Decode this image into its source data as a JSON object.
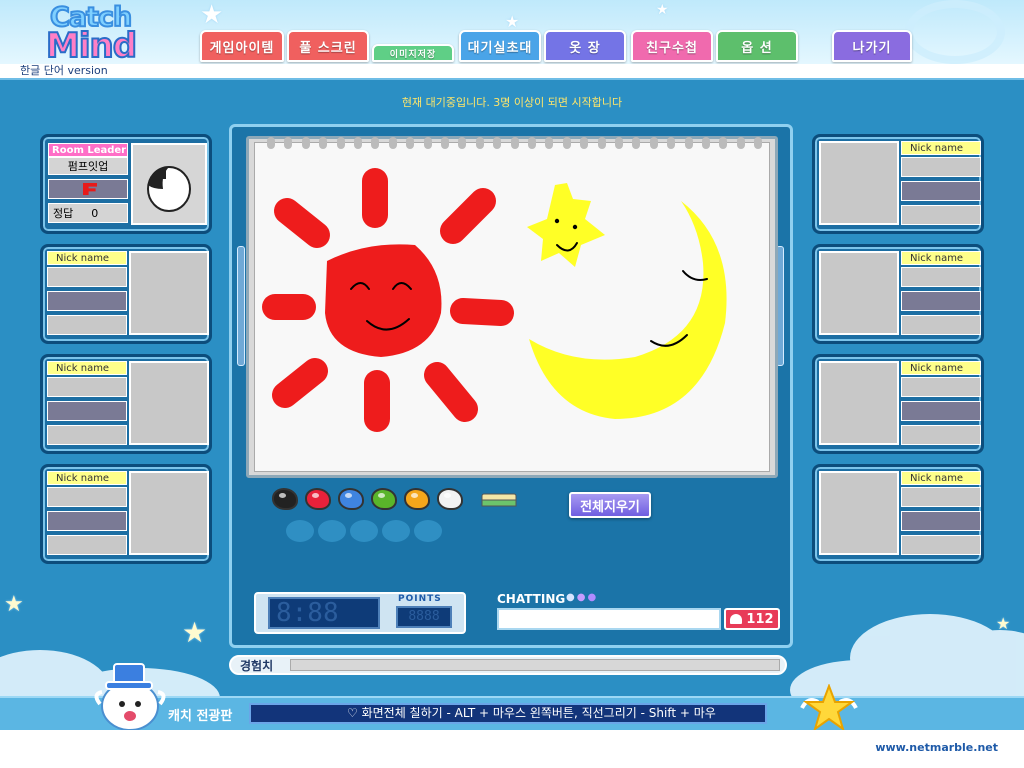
{
  "app": {
    "logo_line1": "Catch",
    "logo_line2": "Mind",
    "subtitle": "한글 단어 version",
    "site": "www.netmarble.net"
  },
  "tabs": [
    {
      "label": "게임아이템",
      "color": "#f0605f"
    },
    {
      "label": "풀 스크린",
      "color": "#f0605f"
    },
    {
      "label": "이미지저장",
      "color": "#5fcf86"
    },
    {
      "label": "대기실초대",
      "color": "#4aa4e8"
    },
    {
      "label": "옷 장",
      "color": "#7474e6"
    },
    {
      "label": "친구수첩",
      "color": "#f06aae"
    },
    {
      "label": "옵 션",
      "color": "#5dbf6c"
    },
    {
      "label": "나가기",
      "color": "#8a6ce0"
    }
  ],
  "status_message": "현재 대기중입니다. 3명 이상이 되면 시작합니다",
  "leader": {
    "header": "Room Leader",
    "name": "펌프잇업",
    "score_label": "정답",
    "score": "0"
  },
  "player_slots": {
    "nick_label": "Nick name"
  },
  "palette": [
    {
      "name": "black",
      "color": "#222222"
    },
    {
      "name": "red",
      "color": "#e8213a"
    },
    {
      "name": "blue",
      "color": "#3f84e0"
    },
    {
      "name": "green",
      "color": "#5ab52a"
    },
    {
      "name": "orange",
      "color": "#f5a61b"
    },
    {
      "name": "white",
      "color": "#f2f2f2"
    }
  ],
  "canvas_colors": {
    "sun": "#ee1c1c",
    "moon": "#ffff26",
    "face": "#000000"
  },
  "clear_button": "전체지우기",
  "timer": {
    "display": "8:88",
    "points_label": "POINTS",
    "points_display": "8888"
  },
  "chat": {
    "label": "CHATTING",
    "count": "112",
    "dots": [
      "#d6e4ff",
      "#c79cff",
      "#b08bff"
    ]
  },
  "experience": {
    "label": "경험치"
  },
  "ticker": {
    "label": "캐치 전광판",
    "text": "♡ 화면전체 칠하기 - ALT + 마우스 왼쪽버튼, 직선그리기 - Shift + 마우"
  }
}
